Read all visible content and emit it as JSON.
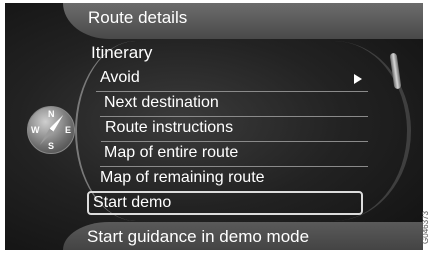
{
  "header": {
    "title": "Route details"
  },
  "menu": {
    "heading": "Itinerary",
    "items": [
      {
        "label": "Avoid",
        "has_submenu": true
      },
      {
        "label": "Next destination"
      },
      {
        "label": "Route instructions"
      },
      {
        "label": "Map of entire route"
      },
      {
        "label": "Map of remaining route"
      }
    ],
    "selected_label": "Start demo"
  },
  "compass": {
    "n": "N",
    "s": "S",
    "w": "W",
    "e": "E"
  },
  "footer": {
    "hint": "Start guidance in demo mode"
  },
  "figure_code": "G046373",
  "colors": {
    "background": "#1c1c1c",
    "header": "#5a5a5a",
    "text": "#ffffff",
    "selection_border": "#dcdcdc"
  }
}
